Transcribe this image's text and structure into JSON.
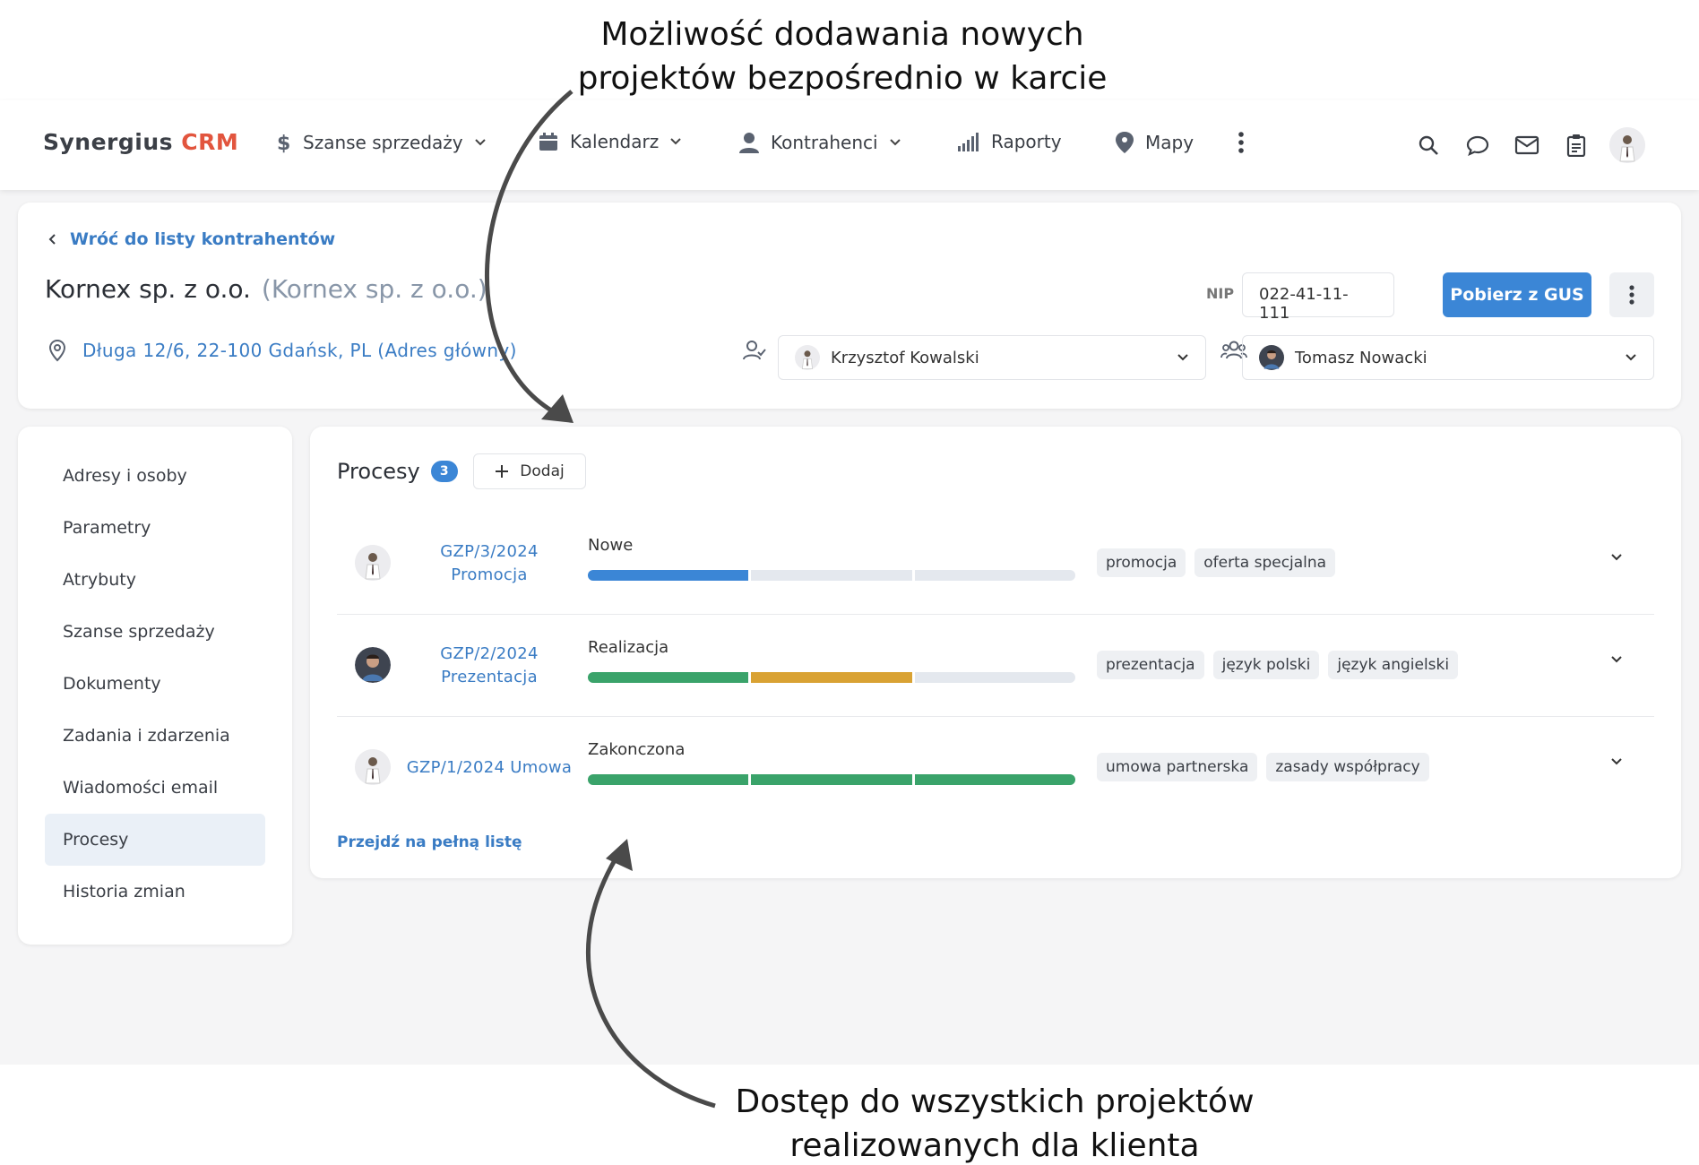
{
  "callouts": {
    "top_line1": "Możliwość dodawania nowych",
    "top_line2": "projektów bezpośrednio w karcie",
    "bottom_line1": "Dostęp do wszystkich projektów",
    "bottom_line2": "realizowanych dla klienta"
  },
  "nav": {
    "logo_main": "Synergius",
    "logo_accent": "CRM",
    "items": [
      {
        "label": "Szanse sprzedaży",
        "icon": "dollar-icon"
      },
      {
        "label": "Kalendarz",
        "icon": "calendar-icon"
      },
      {
        "label": "Kontrahenci",
        "icon": "person-icon"
      },
      {
        "label": "Raporty",
        "icon": "signal-bars-icon"
      },
      {
        "label": "Mapy",
        "icon": "map-pin-icon"
      }
    ]
  },
  "header": {
    "back": "Wróć do listy kontrahentów",
    "company": "Kornex sp. z o.o.",
    "company_alias": "(Kornex sp. z o.o.)",
    "address": "Długa 12/6, 22-100 Gdańsk, PL (Adres główny)",
    "nip_label": "NIP",
    "nip_value": "022-41-11-111",
    "gus_button": "Pobierz z GUS",
    "owner": "Krzysztof Kowalski",
    "team": "Tomasz Nowacki"
  },
  "sidebar": {
    "items": [
      "Adresy i osoby",
      "Parametry",
      "Atrybuty",
      "Szanse sprzedaży",
      "Dokumenty",
      "Zadania i zdarzenia",
      "Wiadomości email",
      "Procesy",
      "Historia zmian"
    ],
    "active": "Procesy"
  },
  "processes": {
    "title": "Procesy",
    "count": "3",
    "add_label": "Dodaj",
    "full_list": "Przejdź na pełną listę",
    "rows": [
      {
        "id": "GZP/3/2024 Promocja",
        "status": "Nowe",
        "stages": [
          "#3b86d6",
          "",
          ""
        ],
        "tags": [
          "promocja",
          "oferta specjalna"
        ]
      },
      {
        "id": "GZP/2/2024 Prezentacja",
        "status": "Realizacja",
        "stages": [
          "#3aa36a",
          "#d9a233",
          ""
        ],
        "tags": [
          "prezentacja",
          "język polski",
          "język angielski"
        ]
      },
      {
        "id": "GZP/1/2024 Umowa",
        "status": "Zakonczona",
        "stages": [
          "#3aa36a",
          "#3aa36a",
          "#3aa36a"
        ],
        "tags": [
          "umowa partnerska",
          "zasady współpracy"
        ]
      }
    ]
  }
}
